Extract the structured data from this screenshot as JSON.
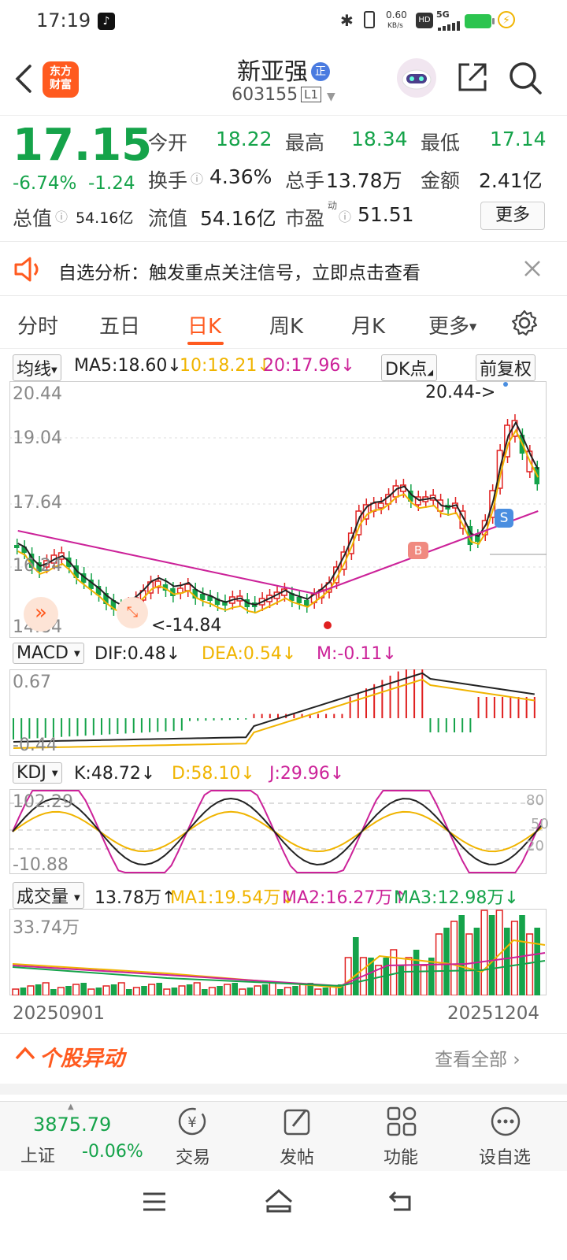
{
  "status": {
    "time": "17:19",
    "net_speed": "0.60",
    "net_unit": "KB/s",
    "sim": "5G"
  },
  "header": {
    "logo_line1": "东方",
    "logo_line2": "财富",
    "stock_name": "新亚强",
    "name_badge": "正",
    "stock_code": "603155",
    "level_badge": "L1"
  },
  "quote": {
    "price": "17.15",
    "change_pct": "-6.74%",
    "change_abs": "-1.24",
    "open_label": "今开",
    "open": "18.22",
    "high_label": "最高",
    "high": "18.34",
    "low_label": "最低",
    "low": "17.14",
    "turnover_label": "换手",
    "turnover": "4.36%",
    "volume_label": "总手",
    "volume": "13.78万",
    "amount_label": "金额",
    "amount": "2.41亿",
    "mktcap_label": "总值",
    "mktcap": "54.16亿",
    "float_label": "流值",
    "float_cap": "54.16亿",
    "pe_label": "市盈",
    "pe_sup": "动",
    "pe": "51.51",
    "more_label": "更多"
  },
  "alert": {
    "text": "自选分析：触发重点关注信号，立即点击查看"
  },
  "tabs": [
    "分时",
    "五日",
    "日K",
    "周K",
    "月K",
    "更多"
  ],
  "active_tab": "日K",
  "ma_row": {
    "selector": "均线",
    "ma5": "MA5:18.60↓",
    "ma10": "10:18.21↓",
    "ma20": "20:17.96↓",
    "dk": "DK点",
    "adjust": "前复权"
  },
  "kline_axis": {
    "top": "20.44",
    "mid1": "19.04",
    "mid2": "17.64",
    "mid3": "16.24",
    "bottom": "14.84",
    "max_marker": "20.44->",
    "min_marker": "<-14.84"
  },
  "macd": {
    "selector": "MACD",
    "dif": "DIF:0.48↓",
    "dea": "DEA:0.54↓",
    "m": "M:-0.11↓",
    "top": "0.67",
    "bottom": "-0.44"
  },
  "kdj": {
    "selector": "KDJ",
    "k": "K:48.72↓",
    "d": "D:58.10↓",
    "j": "J:29.96↓",
    "top": "102.29",
    "bottom": "-10.88",
    "r80": "80",
    "r50": "50",
    "r20": "20"
  },
  "volume": {
    "selector": "成交量",
    "vol": "13.78万↑",
    "ma1": "MA1:19.54万↓",
    "ma2": "MA2:16.27万↑",
    "ma3": "MA3:12.98万↓",
    "top": "33.74万"
  },
  "dates": {
    "start": "20250901",
    "end": "20251204"
  },
  "movers": {
    "title": "个股异动",
    "link": "查看全部"
  },
  "index": {
    "value": "3875.79",
    "name": "上证",
    "change": "-0.06%"
  },
  "bottom_nav": [
    "交易",
    "发帖",
    "功能",
    "设自选"
  ],
  "colors": {
    "up": "#e02020",
    "down": "#15a34a",
    "accent": "#ff5a1f",
    "ma10": "#f0b400",
    "ma20": "#cc2299"
  },
  "icons": [
    "back-icon",
    "robot-avatar-icon",
    "share-icon",
    "search-icon",
    "speaker-icon",
    "close-icon",
    "gear-icon",
    "trade-icon",
    "post-icon",
    "function-icon",
    "add-watch-icon",
    "menu-icon",
    "home-icon",
    "return-icon"
  ]
}
